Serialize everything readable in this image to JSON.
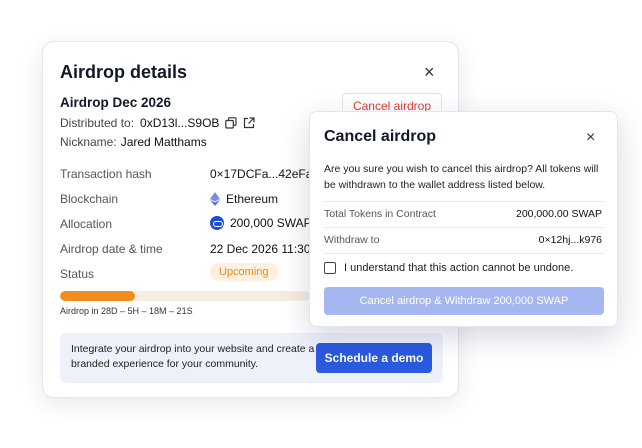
{
  "details": {
    "title": "Airdrop details",
    "close_glyph": "×",
    "airdrop_name": "Airdrop Dec 2026",
    "distributed_label": "Distributed to:",
    "distributed_value": "0xD13l...S9OB",
    "nickname_label": "Nickname:",
    "nickname_value": "Jared Matthams",
    "cancel_label": "Cancel airdrop",
    "rows": {
      "tx_label": "Transaction hash",
      "tx_value": "0×17DCFa...42eFal",
      "chain_label": "Blockchain",
      "chain_value": "Ethereum",
      "alloc_label": "Allocation",
      "alloc_value": "200,000 SWAP",
      "date_label": "Airdrop date & time",
      "date_value": "22 Dec 2026 11:30",
      "status_label": "Status",
      "status_value": "Upcoming"
    },
    "progress": {
      "fraction": 0.3,
      "label": "Airdrop in 28D – 5H – 18M – 21S"
    },
    "promo": {
      "text": "Integrate your airdrop into your website and create a branded experience for your community.",
      "button_label": "Schedule a demo"
    }
  },
  "modal": {
    "title": "Cancel airdrop",
    "close_glyph": "×",
    "description": "Are you sure you wish to cancel this airdrop? All tokens will be withdrawn to the wallet address listed below.",
    "total_label": "Total Tokens in Contract",
    "total_value": "200,000.00 SWAP",
    "withdraw_label": "Withdraw to",
    "withdraw_value": "0×12hj...k976",
    "checkbox_label": "I understand that this action cannot be undone.",
    "confirm_label": "Cancel airdrop & Withdraw 200,000 SWAP"
  },
  "colors": {
    "accent": "#2a5ade",
    "danger": "#e53935",
    "status_orange": "#e58a1f",
    "progress_fill": "#f28c1e",
    "confirm_disabled": "#a5b6f0"
  }
}
